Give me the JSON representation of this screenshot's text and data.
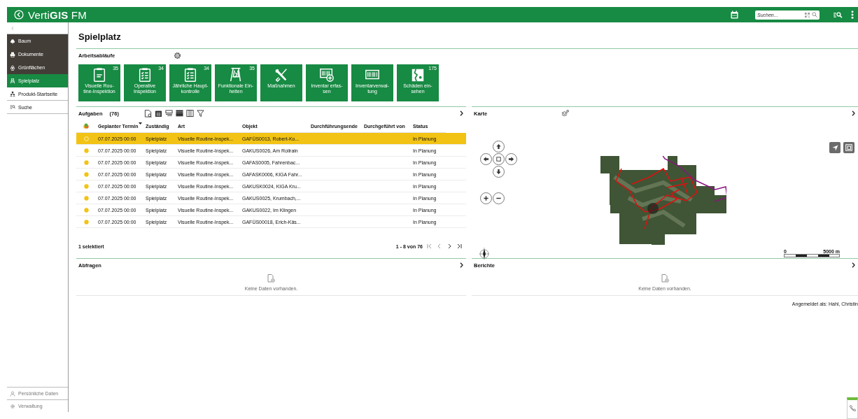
{
  "header": {
    "logo": "Verti**GIS** FM",
    "search": {
      "placeholder": "Suchen..."
    }
  },
  "sidebar": {
    "items": [
      {
        "label": "Baum",
        "kind": "module",
        "selected": false
      },
      {
        "label": "Dokumente",
        "kind": "module",
        "selected": false
      },
      {
        "label": "Grünflächen",
        "kind": "module",
        "selected": false
      },
      {
        "label": "Spielplatz",
        "kind": "module",
        "selected": true
      },
      {
        "label": "Produkt-Startseite",
        "kind": "link",
        "selected": false
      },
      {
        "label": "Suche",
        "kind": "link",
        "selected": false
      }
    ],
    "footer_items": [
      {
        "label": "Persönliche Daten"
      },
      {
        "label": "Verwaltung"
      }
    ]
  },
  "page": {
    "title": "Spielplatz"
  },
  "workflows": {
    "title": "Arbeitsabläufe",
    "tiles": [
      {
        "label": "Visuelle Rou-\ntine-Inspektion",
        "count": "35",
        "kind": "clipboard"
      },
      {
        "label": "Operative\nInspektion",
        "count": "34",
        "kind": "checklist"
      },
      {
        "label": "Jährliche Haupt-\nkontrolle",
        "count": "34",
        "kind": "checklist"
      },
      {
        "label": "Funktionale Ein-\nheiten",
        "count": "35",
        "kind": "swing"
      },
      {
        "label": "Maßnahmen",
        "kind": "tools"
      },
      {
        "label": "Inventar erfas-\nsen",
        "kind": "barcodeplus"
      },
      {
        "label": "Inventarverwal-\ntung",
        "kind": "barcode"
      },
      {
        "label": "Schäden ein-\nsehen",
        "count": "175",
        "kind": "damage"
      }
    ]
  },
  "tasks": {
    "title": "Aufgaben",
    "count": "(76)",
    "columns": [
      "Geplanter Termin",
      "Zuständig",
      "Art",
      "Objekt",
      "Durchführungsende",
      "Durchgeführt von",
      "Status"
    ],
    "rows": [
      {
        "selected": true,
        "cells": [
          "07.07.2025 00:00",
          "Spielplatz",
          "Visuelle Routine-Inspek...",
          "GAFÜS0013, Robert-Ko...",
          "",
          "",
          "In Planung"
        ]
      },
      {
        "selected": false,
        "cells": [
          "07.07.2025 00:00",
          "Spielplatz",
          "Visuelle Routine-Inspek...",
          "GAKUS0026, Am Rollrain",
          "",
          "",
          "In Planung"
        ]
      },
      {
        "selected": false,
        "cells": [
          "07.07.2025 00:00",
          "Spielplatz",
          "Visuelle Routine-Inspek...",
          "GAFAS0005, Fahrenbac...",
          "",
          "",
          "In Planung"
        ]
      },
      {
        "selected": false,
        "cells": [
          "07.07.2025 00:00",
          "Spielplatz",
          "Visuelle Routine-Inspek...",
          "GAFASK0006, KIGA Fahr...",
          "",
          "",
          "In Planung"
        ]
      },
      {
        "selected": false,
        "cells": [
          "07.07.2025 00:00",
          "Spielplatz",
          "Visuelle Routine-Inspek...",
          "GAKUSK0024, KIGA Kru...",
          "",
          "",
          "In Planung"
        ]
      },
      {
        "selected": false,
        "cells": [
          "07.07.2025 00:00",
          "Spielplatz",
          "Visuelle Routine-Inspek...",
          "GAKUS0025, Krumbach,...",
          "",
          "",
          "In Planung"
        ]
      },
      {
        "selected": false,
        "cells": [
          "07.07.2025 00:00",
          "Spielplatz",
          "Visuelle Routine-Inspek...",
          "GAKUS0022, Im Klingen",
          "",
          "",
          "In Planung"
        ]
      },
      {
        "selected": false,
        "cells": [
          "07.07.2025 00:00",
          "Spielplatz",
          "Visuelle Routine-Inspek...",
          "GAFÜS00018, Erich-Käs...",
          "",
          "",
          "In Planung"
        ]
      }
    ],
    "selection": "1 selektiert",
    "pagination": "1 - 8 von 76"
  },
  "map": {
    "title": "Karte",
    "scale_start": "0",
    "scale_end": "5000 m"
  },
  "queries": {
    "title": "Abfragen",
    "empty": "Keine Daten vorhanden."
  },
  "reports": {
    "title": "Berichte",
    "empty": "Keine Daten vorhanden."
  },
  "status_bar": {
    "user": "Angemeldet als: Hahl, Christin"
  }
}
